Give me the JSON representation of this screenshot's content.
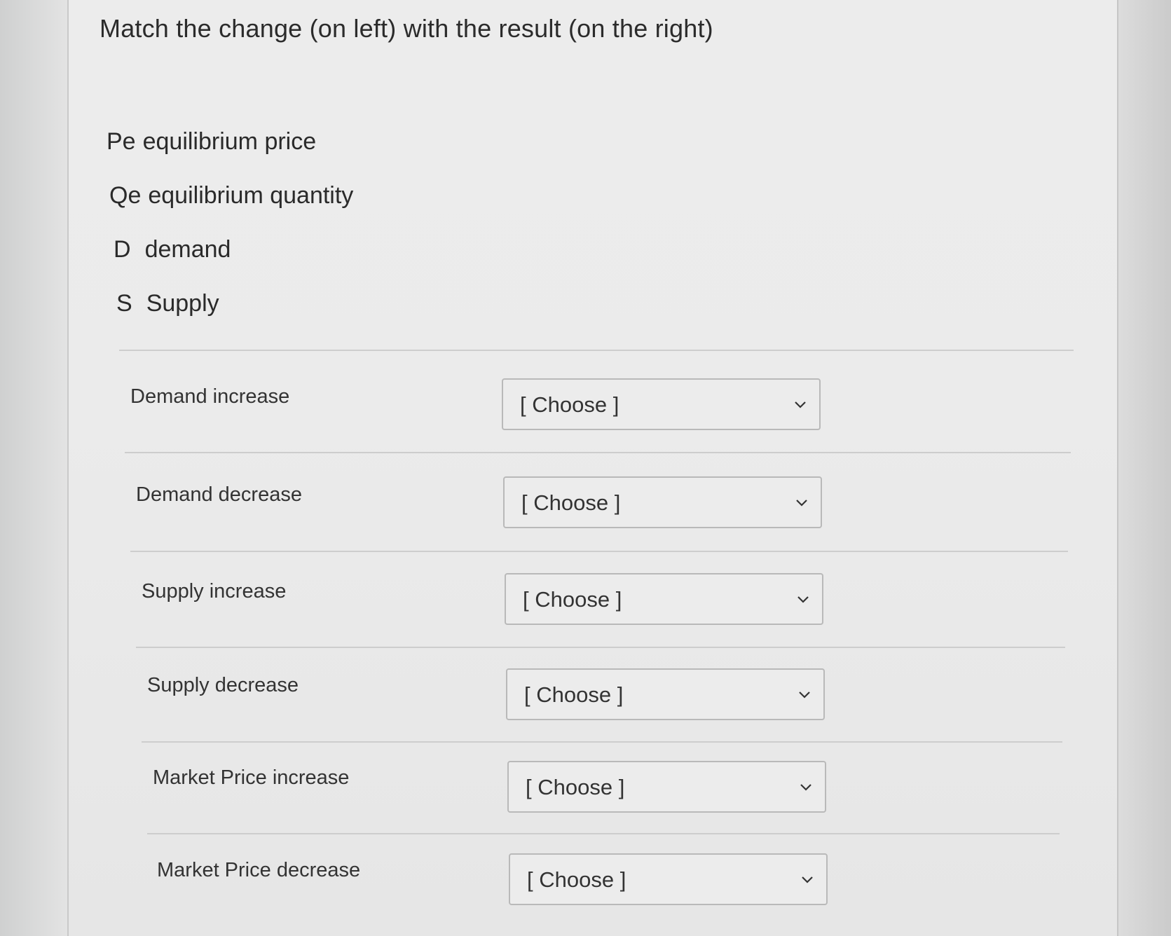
{
  "question": {
    "title": "Match the change (on left) with the result (on the right)"
  },
  "legend": [
    {
      "abbr": "Pe",
      "text": "equilibrium price"
    },
    {
      "abbr": "Qe",
      "text": "equilibrium quantity"
    },
    {
      "abbr": "D",
      "text": "demand"
    },
    {
      "abbr": "S",
      "text": "Supply"
    }
  ],
  "rows": [
    {
      "label": "Demand increase",
      "selected": "[ Choose ]",
      "icon": "chevron-down-icon"
    },
    {
      "label": "Demand decrease",
      "selected": "[ Choose ]",
      "icon": "chevron-down-icon"
    },
    {
      "label": "Supply increase",
      "selected": "[ Choose ]",
      "icon": "chevron-down-icon"
    },
    {
      "label": "Supply decrease",
      "selected": "[ Choose ]",
      "icon": "chevron-down-icon"
    },
    {
      "label": "Market Price increase",
      "selected": "[ Choose ]",
      "icon": "chevron-down-icon"
    },
    {
      "label": "Market Price decrease",
      "selected": "[ Choose ]",
      "icon": "chevron-down-icon"
    }
  ]
}
